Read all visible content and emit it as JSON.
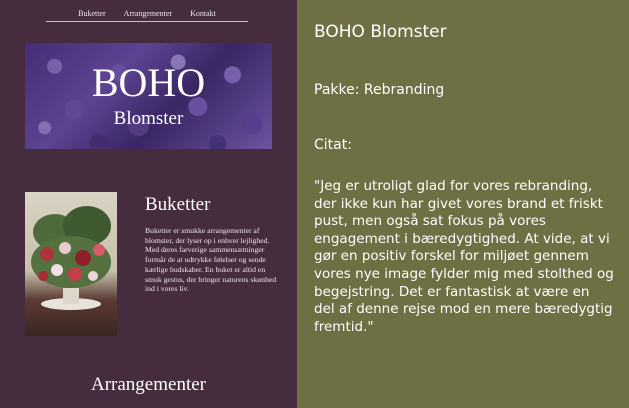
{
  "site": {
    "nav": [
      "Buketter",
      "Arrangementer",
      "Kontakt"
    ],
    "hero": {
      "title": "BOHO",
      "subtitle": "Blomster"
    },
    "bouquets": {
      "title": "Buketter",
      "text": "Buketter er smukke arrangementer af blomster, der lyser op i enhver lejlighed. Med deres farverige sammensætninger formår de at udtrykke følelser og sende kærlige budskaber. En buket er altid en smuk gestus, der bringer naturens skønhed ind i vores liv."
    },
    "arrangements": {
      "title": "Arrangementer"
    }
  },
  "panel": {
    "title": "BOHO Blomster",
    "package": "Pakke: Rebranding",
    "quote_label": "Citat:",
    "quote": "\"Jeg er utroligt glad for vores rebranding, der ikke kun har givet vores brand et friskt pust, men også sat fokus på vores engagement i bæredygtighed. At vide, at vi gør en positiv forskel for miljøet gennem vores nye image fylder mig med stolthed og begejstring. Det er fantastisk at være en del af denne rejse mod en mere bæredygtig fremtid.\""
  },
  "colors": {
    "site_bg": "#452c3f",
    "panel_bg": "#6e7044",
    "text": "#ffffff"
  }
}
